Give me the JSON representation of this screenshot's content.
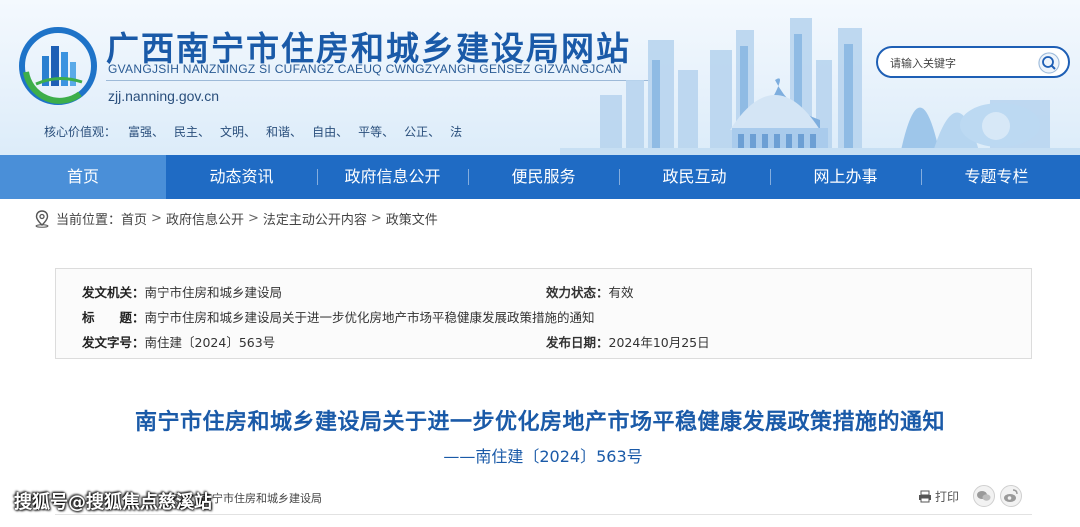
{
  "header": {
    "site_title": "广西南宁市住房和城乡建设局网站",
    "site_pinyin": "GVANGJSIH NANZNINGZ SI CUFANGZ CAEUQ CWNGZYANGH GENSEZ GIZVANGJCAN",
    "domain": "zjj.nanning.gov.cn",
    "values_label": "核心价值观：",
    "values": [
      "富强、",
      "民主、",
      "文明、",
      "和谐、",
      "自由、",
      "平等、",
      "公正、",
      "法"
    ],
    "search_placeholder": "请输入关键字"
  },
  "nav": {
    "items": [
      "首页",
      "动态资讯",
      "政府信息公开",
      "便民服务",
      "政民互动",
      "网上办事",
      "专题专栏"
    ]
  },
  "breadcrumb": {
    "label": "当前位置：",
    "items": [
      "首页",
      "政府信息公开",
      "法定主动公开内容",
      "政策文件"
    ],
    "separator": ">"
  },
  "meta": {
    "issuer_label": "发文机关：",
    "issuer": "南宁市住房和城乡建设局",
    "status_label": "效力状态：",
    "status": "有效",
    "title_label": "标　　题：",
    "title": "南宁市住房和城乡建设局关于进一步优化房地产市场平稳健康发展政策措施的通知",
    "doc_no_label": "发文字号：",
    "doc_no": "南住建〔2024〕563号",
    "date_label": "发布日期：",
    "date": "2024年10月25日"
  },
  "document": {
    "title": "南宁市住房和城乡建设局关于进一步优化房地产市场平稳健康发展政策措施的通知",
    "number": "——南住建〔2024〕563号"
  },
  "footer_bar": {
    "source": "来源：南宁市住房和城乡建设局",
    "print_label": "打印",
    "watermark": "搜狐号@搜狐焦点慈溪站"
  },
  "colors": {
    "brand_blue": "#1a5aa8",
    "nav_blue": "#1f6bc4",
    "nav_active": "#4a8fd8"
  },
  "icons": [
    "logo-emblem",
    "search-icon",
    "location-icon",
    "print-icon",
    "wechat-icon",
    "weibo-icon"
  ]
}
